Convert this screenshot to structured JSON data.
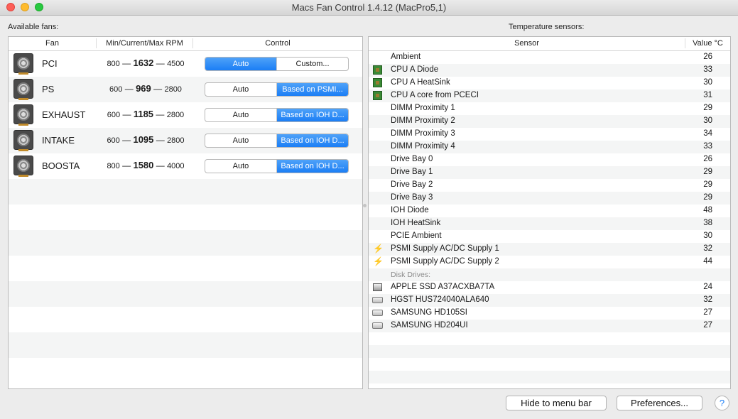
{
  "window": {
    "title": "Macs Fan Control 1.4.12 (MacPro5,1)"
  },
  "fans_panel": {
    "label": "Available fans:",
    "columns": {
      "fan": "Fan",
      "rpm": "Min/Current/Max RPM",
      "control": "Control"
    },
    "fans": [
      {
        "name": "PCI",
        "min": "800",
        "current": "1632",
        "max": "4500",
        "auto": "Auto",
        "custom": "Custom...",
        "selected": "auto"
      },
      {
        "name": "PS",
        "min": "600",
        "current": "969",
        "max": "2800",
        "auto": "Auto",
        "custom": "Based on PSMI...",
        "selected": "custom"
      },
      {
        "name": "EXHAUST",
        "min": "600",
        "current": "1185",
        "max": "2800",
        "auto": "Auto",
        "custom": "Based on IOH D...",
        "selected": "custom"
      },
      {
        "name": "INTAKE",
        "min": "600",
        "current": "1095",
        "max": "2800",
        "auto": "Auto",
        "custom": "Based on IOH D...",
        "selected": "custom"
      },
      {
        "name": "BOOSTA",
        "min": "800",
        "current": "1580",
        "max": "4000",
        "auto": "Auto",
        "custom": "Based on IOH D...",
        "selected": "custom"
      }
    ]
  },
  "sensors_panel": {
    "label": "Temperature sensors:",
    "columns": {
      "sensor": "Sensor",
      "value": "Value °C"
    },
    "rows": [
      {
        "name": "Ambient",
        "value": "26",
        "icon": "none"
      },
      {
        "name": "CPU A Diode",
        "value": "33",
        "icon": "cpu-chip-icon"
      },
      {
        "name": "CPU A HeatSink",
        "value": "30",
        "icon": "cpu-chip-icon"
      },
      {
        "name": "CPU A core from PCECI",
        "value": "31",
        "icon": "cpu-chip-icon"
      },
      {
        "name": "DIMM Proximity 1",
        "value": "29",
        "icon": "none"
      },
      {
        "name": "DIMM Proximity 2",
        "value": "30",
        "icon": "none"
      },
      {
        "name": "DIMM Proximity 3",
        "value": "34",
        "icon": "none"
      },
      {
        "name": "DIMM Proximity 4",
        "value": "33",
        "icon": "none"
      },
      {
        "name": "Drive Bay 0",
        "value": "26",
        "icon": "none"
      },
      {
        "name": "Drive Bay 1",
        "value": "29",
        "icon": "none"
      },
      {
        "name": "Drive Bay 2",
        "value": "29",
        "icon": "none"
      },
      {
        "name": "Drive Bay 3",
        "value": "29",
        "icon": "none"
      },
      {
        "name": "IOH Diode",
        "value": "48",
        "icon": "none"
      },
      {
        "name": "IOH HeatSink",
        "value": "38",
        "icon": "none"
      },
      {
        "name": "PCIE Ambient",
        "value": "30",
        "icon": "none"
      },
      {
        "name": "PSMI Supply AC/DC Supply 1",
        "value": "32",
        "icon": "power-bolt-icon"
      },
      {
        "name": "PSMI Supply AC/DC Supply 2",
        "value": "44",
        "icon": "power-bolt-icon"
      },
      {
        "name": "Disk Drives:",
        "value": "",
        "icon": "group"
      },
      {
        "name": "APPLE SSD A37ACXBA7TA",
        "value": "24",
        "icon": "ssd-icon"
      },
      {
        "name": "HGST HUS724040ALA640",
        "value": "32",
        "icon": "hard-drive-icon"
      },
      {
        "name": "SAMSUNG HD105SI",
        "value": "27",
        "icon": "hard-drive-icon"
      },
      {
        "name": "SAMSUNG HD204UI",
        "value": "27",
        "icon": "hard-drive-icon"
      }
    ]
  },
  "footer": {
    "hide_label": "Hide to menu bar",
    "prefs_label": "Preferences...",
    "help_label": "?"
  }
}
